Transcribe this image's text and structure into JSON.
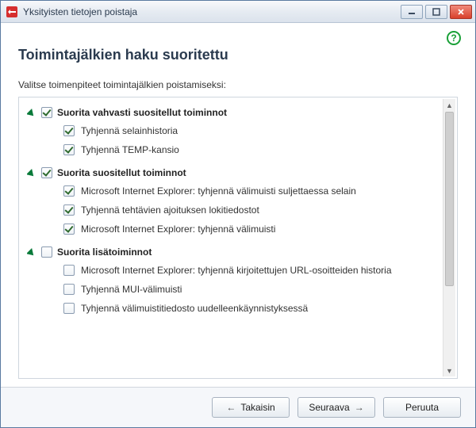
{
  "window": {
    "title": "Yksityisten tietojen poistaja"
  },
  "main": {
    "heading": "Toimintajälkien haku suoritettu",
    "subheading": "Valitse toimenpiteet toimintajälkien poistamiseksi:"
  },
  "groups": [
    {
      "label": "Suorita vahvasti suositellut toiminnot",
      "checked": true,
      "expanded": true,
      "items": [
        {
          "label": "Tyhjennä selainhistoria",
          "checked": true
        },
        {
          "label": "Tyhjennä TEMP-kansio",
          "checked": true
        }
      ]
    },
    {
      "label": "Suorita suositellut toiminnot",
      "checked": true,
      "expanded": true,
      "items": [
        {
          "label": "Microsoft Internet Explorer: tyhjennä välimuisti suljettaessa selain",
          "checked": true
        },
        {
          "label": "Tyhjennä tehtävien ajoituksen lokitiedostot",
          "checked": true
        },
        {
          "label": "Microsoft Internet Explorer: tyhjennä välimuisti",
          "checked": true
        }
      ]
    },
    {
      "label": "Suorita lisätoiminnot",
      "checked": false,
      "expanded": true,
      "items": [
        {
          "label": "Microsoft Internet Explorer: tyhjennä kirjoitettujen URL-osoitteiden historia",
          "checked": false
        },
        {
          "label": "Tyhjennä MUI-välimuisti",
          "checked": false
        },
        {
          "label": "Tyhjennä välimuistitiedosto uudelleenkäynnistyksessä",
          "checked": false
        }
      ]
    }
  ],
  "footer": {
    "back": "Takaisin",
    "next": "Seuraava",
    "cancel": "Peruuta"
  }
}
